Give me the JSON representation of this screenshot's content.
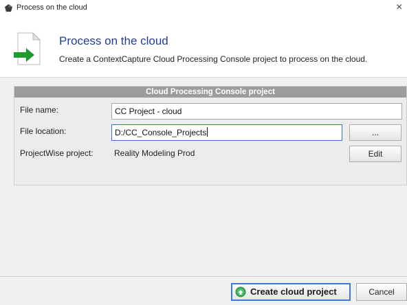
{
  "window": {
    "title": "Process on the cloud",
    "close_glyph": "×",
    "app_icon": "gem-icon"
  },
  "header": {
    "title": "Process on the cloud",
    "description": "Create a ContextCapture Cloud Processing Console project to process on the cloud.",
    "icon": "document-arrow-icon",
    "title_color": "#1f3f96"
  },
  "group": {
    "title": "Cloud Processing Console project",
    "file_name": {
      "label": "File name:",
      "value": "CC Project - cloud"
    },
    "file_location": {
      "label": "File location:",
      "value": "D:/CC_Console_Projects",
      "browse_label": "..."
    },
    "projectwise": {
      "label": "ProjectWise project:",
      "value": "Reality Modeling Prod",
      "edit_label": "Edit"
    }
  },
  "footer": {
    "create_label": "Create cloud project",
    "create_icon": "cloud-arrow-icon",
    "cancel_label": "Cancel",
    "accent_color": "#3b7bd8"
  }
}
